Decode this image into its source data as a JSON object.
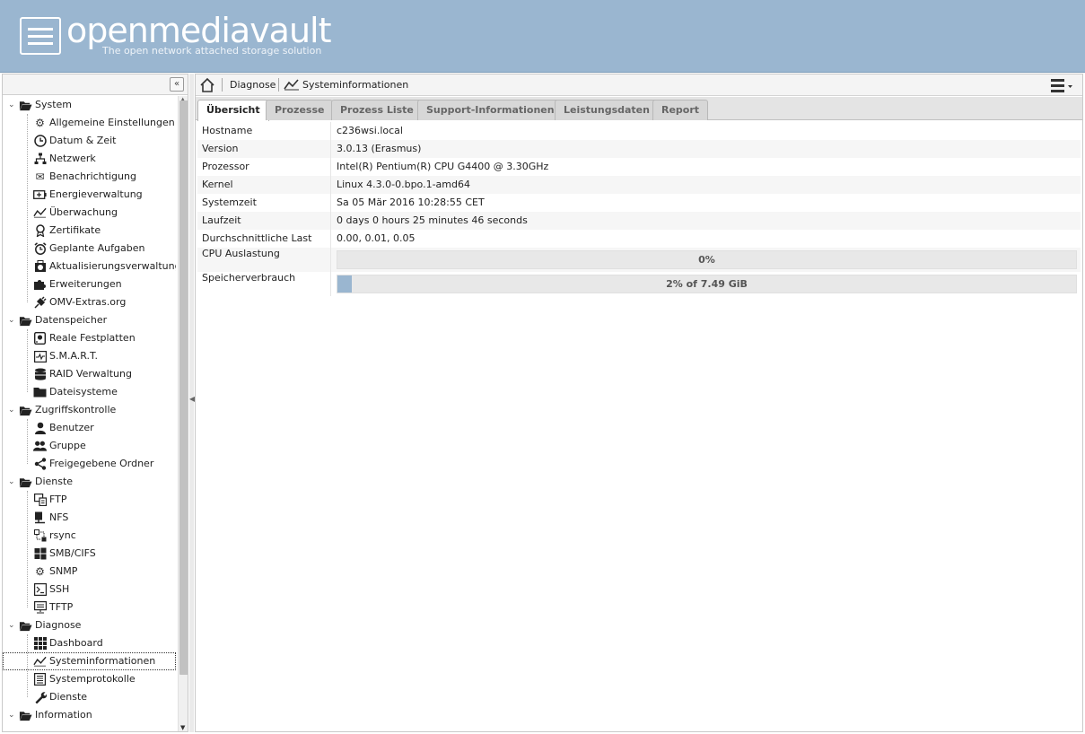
{
  "header": {
    "title": "openmediavault",
    "subtitle": "The open network attached storage solution"
  },
  "colors": {
    "header_bg": "#9ab6d0",
    "progress_fill": "#9ab6d0"
  },
  "sidebar": {
    "collapse_label": "«",
    "groups": [
      {
        "label": "System",
        "icon": "folder-open-icon",
        "items": [
          {
            "label": "Allgemeine Einstellungen",
            "icon": "gears-icon"
          },
          {
            "label": "Datum & Zeit",
            "icon": "clock-icon"
          },
          {
            "label": "Netzwerk",
            "icon": "network-icon"
          },
          {
            "label": "Benachrichtigung",
            "icon": "envelope-icon"
          },
          {
            "label": "Energieverwaltung",
            "icon": "battery-icon"
          },
          {
            "label": "Überwachung",
            "icon": "chart-line-icon"
          },
          {
            "label": "Zertifikate",
            "icon": "certificate-icon"
          },
          {
            "label": "Geplante Aufgaben",
            "icon": "alarm-clock-icon"
          },
          {
            "label": "Aktualisierungsverwaltung",
            "icon": "download-icon"
          },
          {
            "label": "Erweiterungen",
            "icon": "puzzle-icon"
          },
          {
            "label": "OMV-Extras.org",
            "icon": "plug-icon"
          }
        ]
      },
      {
        "label": "Datenspeicher",
        "icon": "folder-open-icon",
        "items": [
          {
            "label": "Reale Festplatten",
            "icon": "hdd-icon"
          },
          {
            "label": "S.M.A.R.T.",
            "icon": "heartbeat-icon"
          },
          {
            "label": "RAID Verwaltung",
            "icon": "database-icon"
          },
          {
            "label": "Dateisysteme",
            "icon": "folder-icon"
          }
        ]
      },
      {
        "label": "Zugriffskontrolle",
        "icon": "folder-open-icon",
        "items": [
          {
            "label": "Benutzer",
            "icon": "user-icon"
          },
          {
            "label": "Gruppe",
            "icon": "users-icon"
          },
          {
            "label": "Freigegebene Ordner",
            "icon": "share-icon"
          }
        ]
      },
      {
        "label": "Dienste",
        "icon": "folder-open-icon",
        "items": [
          {
            "label": "FTP",
            "icon": "ftp-icon"
          },
          {
            "label": "NFS",
            "icon": "nfs-icon"
          },
          {
            "label": "rsync",
            "icon": "rsync-icon"
          },
          {
            "label": "SMB/CIFS",
            "icon": "windows-icon"
          },
          {
            "label": "SNMP",
            "icon": "gear-icon"
          },
          {
            "label": "SSH",
            "icon": "terminal-icon"
          },
          {
            "label": "TFTP",
            "icon": "tftp-icon"
          }
        ]
      },
      {
        "label": "Diagnose",
        "icon": "folder-open-icon",
        "items": [
          {
            "label": "Dashboard",
            "icon": "dashboard-grid-icon"
          },
          {
            "label": "Systeminformationen",
            "icon": "chart-line-icon",
            "selected": true
          },
          {
            "label": "Systemprotokolle",
            "icon": "log-icon"
          },
          {
            "label": "Dienste",
            "icon": "wrench-icon"
          }
        ]
      },
      {
        "label": "Information",
        "icon": "folder-open-icon",
        "items": []
      }
    ]
  },
  "breadcrumb": {
    "items": [
      "Diagnose",
      "Systeminformationen"
    ]
  },
  "tabs": [
    {
      "label": "Übersicht",
      "active": true
    },
    {
      "label": "Prozesse"
    },
    {
      "label": "Prozess Liste"
    },
    {
      "label": "Support-Informationen"
    },
    {
      "label": "Leistungsdaten"
    },
    {
      "label": "Report"
    }
  ],
  "overview": {
    "rows": [
      {
        "key": "Hostname",
        "value": "c236wsi.local"
      },
      {
        "key": "Version",
        "value": "3.0.13 (Erasmus)"
      },
      {
        "key": "Prozessor",
        "value": "Intel(R) Pentium(R) CPU G4400 @ 3.30GHz"
      },
      {
        "key": "Kernel",
        "value": "Linux 4.3.0-0.bpo.1-amd64"
      },
      {
        "key": "Systemzeit",
        "value": "Sa 05 Mär 2016 10:28:55 CET"
      },
      {
        "key": "Laufzeit",
        "value": "0 days 0 hours 25 minutes 46 seconds"
      },
      {
        "key": "Durchschnittliche Last",
        "value": "0.00, 0.01, 0.05"
      }
    ],
    "cpu": {
      "key": "CPU Auslastung",
      "label": "0%",
      "fraction": 0.0
    },
    "memory": {
      "key": "Speicherverbrauch",
      "label": "2% of 7.49 GiB",
      "fraction": 0.02
    }
  }
}
